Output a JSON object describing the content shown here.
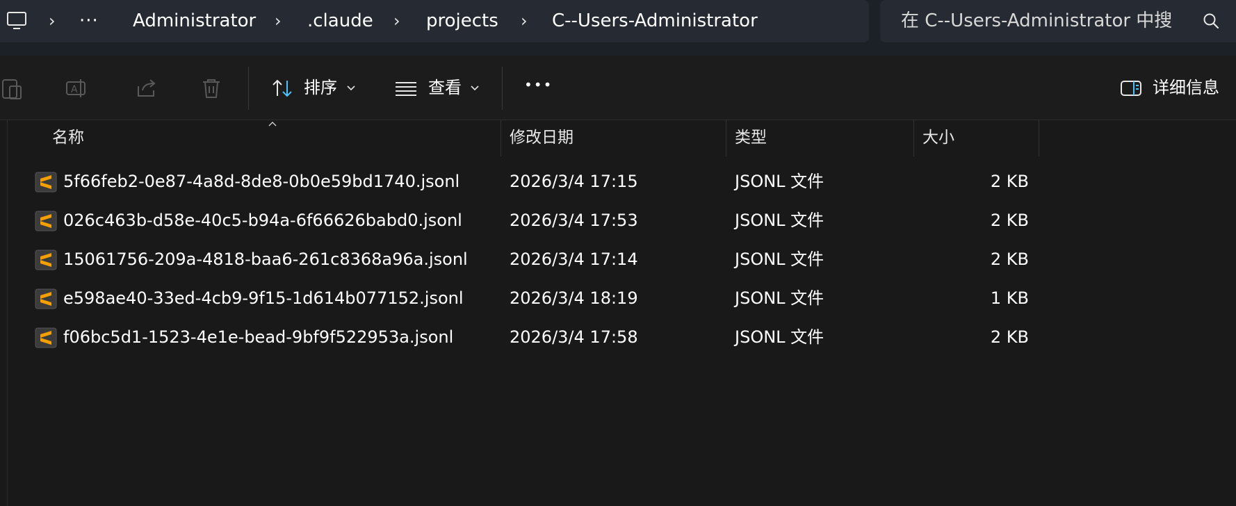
{
  "breadcrumb": {
    "overflow_label": "···",
    "items": [
      "Administrator",
      ".claude",
      "projects",
      "C--Users-Administrator"
    ]
  },
  "search": {
    "placeholder": "在 C--Users-Administrator 中搜索"
  },
  "commandbar": {
    "sort_label": "排序",
    "view_label": "查看",
    "more_label": "•••",
    "details_label": "详细信息"
  },
  "columns": {
    "name": "名称",
    "modified": "修改日期",
    "type": "类型",
    "size": "大小"
  },
  "files": [
    {
      "name": "5f66feb2-0e87-4a8d-8de8-0b0e59bd1740.jsonl",
      "modified": "2026/3/4 17:15",
      "type": "JSONL 文件",
      "size": "2 KB"
    },
    {
      "name": "026c463b-d58e-40c5-b94a-6f66626babd0.jsonl",
      "modified": "2026/3/4 17:53",
      "type": "JSONL 文件",
      "size": "2 KB"
    },
    {
      "name": "15061756-209a-4818-baa6-261c8368a96a.jsonl",
      "modified": "2026/3/4 17:14",
      "type": "JSONL 文件",
      "size": "2 KB"
    },
    {
      "name": "e598ae40-33ed-4cb9-9f15-1d614b077152.jsonl",
      "modified": "2026/3/4 18:19",
      "type": "JSONL 文件",
      "size": "1 KB"
    },
    {
      "name": "f06bc5d1-1523-4e1e-bead-9bf9f522953a.jsonl",
      "modified": "2026/3/4 17:58",
      "type": "JSONL 文件",
      "size": "2 KB"
    }
  ],
  "colors": {
    "background": "#191919",
    "accent": "#4cc2ff",
    "file_icon": "#f59f00"
  }
}
